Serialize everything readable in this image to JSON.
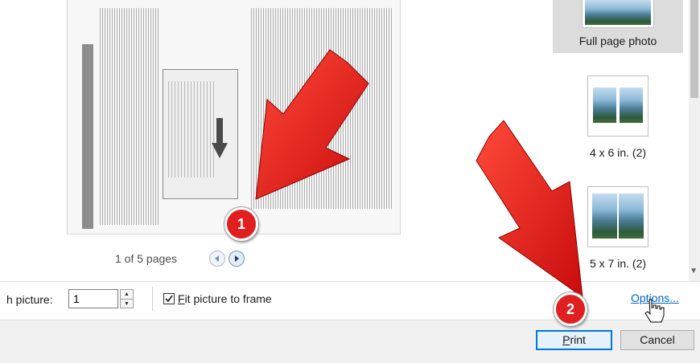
{
  "preview": {
    "pager_text": "1 of 5 pages",
    "prev_icon": "chevron-left-icon",
    "next_icon": "chevron-right-icon"
  },
  "layouts": [
    {
      "label": "Full page photo",
      "selected": true
    },
    {
      "label": "4 x 6 in. (2)",
      "selected": false
    },
    {
      "label": "5 x 7 in. (2)",
      "selected": false
    }
  ],
  "options_bar": {
    "copies_label": "h picture:",
    "copies_value": "1",
    "fit_checked": true,
    "fit_prefix": "F",
    "fit_rest": "it picture to frame",
    "options_link": "Options..."
  },
  "footer": {
    "print_prefix": "P",
    "print_rest": "rint",
    "cancel_label": "Cancel"
  },
  "annotations": [
    {
      "number": "1",
      "color": "#e02020"
    },
    {
      "number": "2",
      "color": "#e02020"
    }
  ],
  "colors": {
    "accent": "#0078d7",
    "link": "#0066cc",
    "annotation_red": "#e02020"
  }
}
